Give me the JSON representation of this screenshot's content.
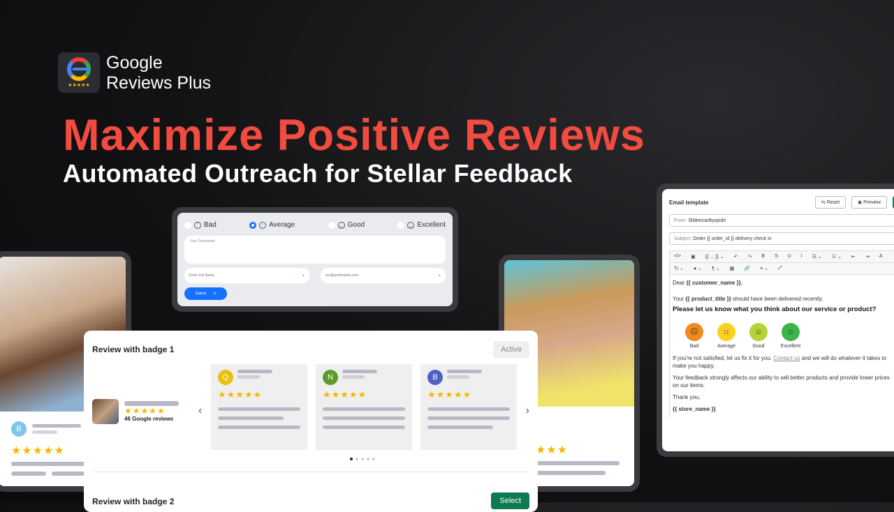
{
  "brand": {
    "line1": "Google",
    "line2": "Reviews Plus",
    "stars": "★★★★★"
  },
  "headline": "Maximize Positive Reviews",
  "subheadline": "Automated Outreach for Stellar Feedback",
  "colors": {
    "headline": "#f24b3f",
    "primary": "#1472ff",
    "green": "#0e7a52",
    "star": "#f5b800"
  },
  "form": {
    "options": [
      {
        "label": "Bad",
        "selected": false
      },
      {
        "label": "Average",
        "selected": true
      },
      {
        "label": "Good",
        "selected": false
      },
      {
        "label": "Excellent",
        "selected": false
      }
    ],
    "comments_placeholder": "Your Comments",
    "name_placeholder": "Enter Full Name",
    "email_value": "avi@qodemedia.com",
    "submit": "Submit"
  },
  "left_card": {
    "avatar": "B",
    "stars": "★★★★★"
  },
  "right_card": {
    "stars": "★★★"
  },
  "widget": {
    "title1": "Review with badge 1",
    "active": "Active",
    "business_stars": "★★★★★",
    "review_count": "46 Google reviews",
    "cards": [
      {
        "initial": "Q",
        "color": "#e8bf12",
        "stars": "★★★★★"
      },
      {
        "initial": "N",
        "color": "#5a9b2a",
        "stars": "★★★★★"
      },
      {
        "initial": "B",
        "color": "#5060c0",
        "stars": "★★★★★"
      }
    ],
    "title2": "Review with badge 2",
    "select": "Select"
  },
  "email": {
    "title": "Email template",
    "reset": "Reset",
    "preview": "Preview",
    "from_label": "From:",
    "from_value": "Slideecartbyqode",
    "subject_label": "Subject:",
    "subject_value": "Order {{ order_id }} delivery check in",
    "toolbar_row1": [
      "</>",
      "▣",
      "{{ ... }} ⌄",
      "↶",
      "↷",
      "B",
      "S",
      "U",
      "I",
      "☰ ⌄",
      "☷ ⌄",
      "⇤",
      "⇥",
      "A"
    ],
    "toolbar_row2": [
      "Tı ⌄",
      "● ⌄",
      "¶ ⌄",
      "▦",
      "🔗",
      "≡ ⌄",
      "⤢"
    ],
    "dear": "Dear ",
    "customer_var": "{{ customer_name }}",
    "your": "Your ",
    "product_var": "{{ product_title }}",
    "delivered": " should have been delivered recently.",
    "question": "Please let us know what you think about our service or product?",
    "ratings": [
      {
        "label": "Bad",
        "color": "#f28a1e",
        "face": "☹"
      },
      {
        "label": "Average",
        "color": "#fdd21e",
        "face": "😐"
      },
      {
        "label": "Good",
        "color": "#b5d334",
        "face": "☺"
      },
      {
        "label": "Excellent",
        "color": "#3bb54a",
        "face": "☺"
      }
    ],
    "fix1": "If you're not satisfied, let us fix it for you. ",
    "contact": "Contact us",
    "fix2": " and we will do whatever it takes to make you happy.",
    "feedback": "Your feedback strongly affects our ability to sell better products and provide lower prices on our items.",
    "thanks": "Thank you,",
    "store_var": "{{ store_name }}"
  }
}
